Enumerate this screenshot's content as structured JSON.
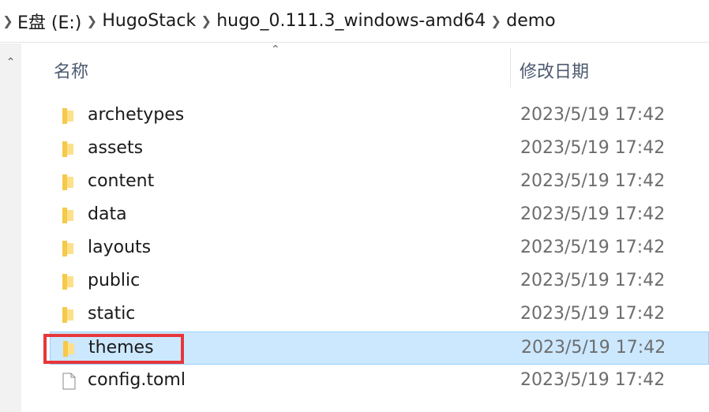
{
  "breadcrumb": {
    "items": [
      "E盘 (E:)",
      "HugoStack",
      "hugo_0.111.3_windows-amd64",
      "demo"
    ]
  },
  "header": {
    "name_label": "名称",
    "date_label": "修改日期"
  },
  "files": [
    {
      "name": "archetypes",
      "date": "2023/5/19 17:42",
      "type": "folder"
    },
    {
      "name": "assets",
      "date": "2023/5/19 17:42",
      "type": "folder"
    },
    {
      "name": "content",
      "date": "2023/5/19 17:42",
      "type": "folder"
    },
    {
      "name": "data",
      "date": "2023/5/19 17:42",
      "type": "folder"
    },
    {
      "name": "layouts",
      "date": "2023/5/19 17:42",
      "type": "folder"
    },
    {
      "name": "public",
      "date": "2023/5/19 17:42",
      "type": "folder"
    },
    {
      "name": "static",
      "date": "2023/5/19 17:42",
      "type": "folder"
    },
    {
      "name": "themes",
      "date": "2023/5/19 17:42",
      "type": "folder",
      "selected": true
    },
    {
      "name": "config.toml",
      "date": "2023/5/19 17:42",
      "type": "file"
    }
  ],
  "colors": {
    "selection": "#cce8ff",
    "annotation": "#e8363a",
    "folder": "#f6c94a"
  }
}
